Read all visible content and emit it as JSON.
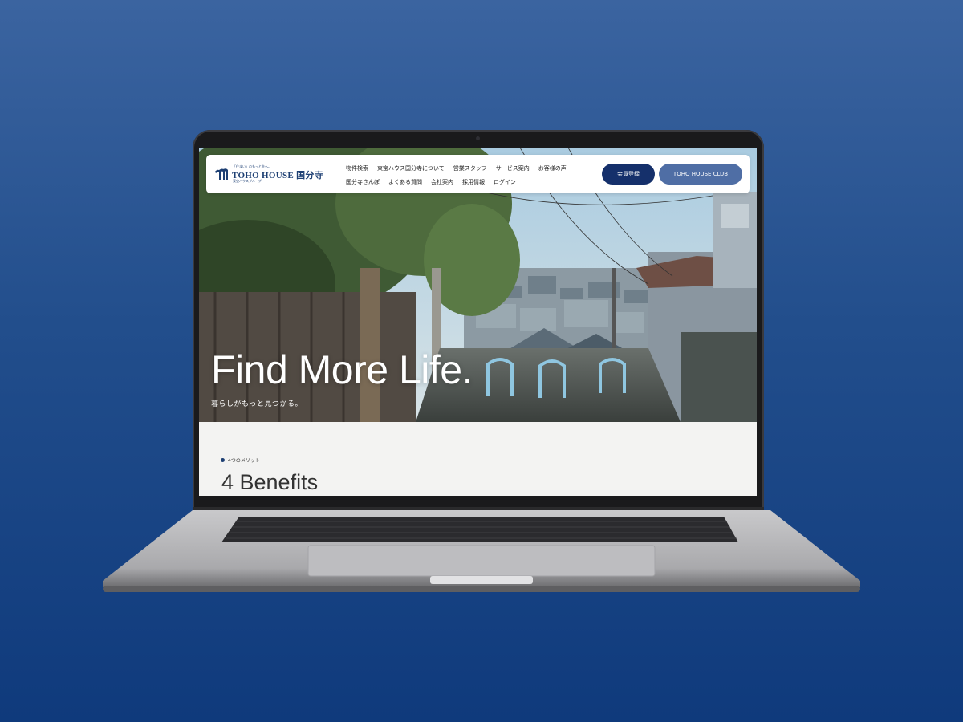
{
  "header": {
    "logo": {
      "tagline": "「住まい」のもっと先へ。",
      "name": "TOHO HOUSE 国分寺",
      "group": "東宝ハウスグループ"
    },
    "nav_row1": [
      "物件検索",
      "東宝ハウス国分寺について",
      "営業スタッフ",
      "サービス案内",
      "お客様の声"
    ],
    "nav_row2": [
      "国分寺さんぽ",
      "よくある質問",
      "会社案内",
      "採用情報",
      "ログイン"
    ],
    "member_button": "会員登録",
    "club_button": "TOHO HOUSE CLUB"
  },
  "hero": {
    "title": "Find More Life.",
    "subtitle": "暮らしがもっと見つかる。"
  },
  "benefits": {
    "label": "4つのメリット",
    "title": "4 Benefits"
  },
  "colors": {
    "brand_navy": "#15306b",
    "brand_blue": "#4f6ea5",
    "background_gradient_top": "#3b64a0",
    "background_gradient_bottom": "#0f3a7c"
  }
}
